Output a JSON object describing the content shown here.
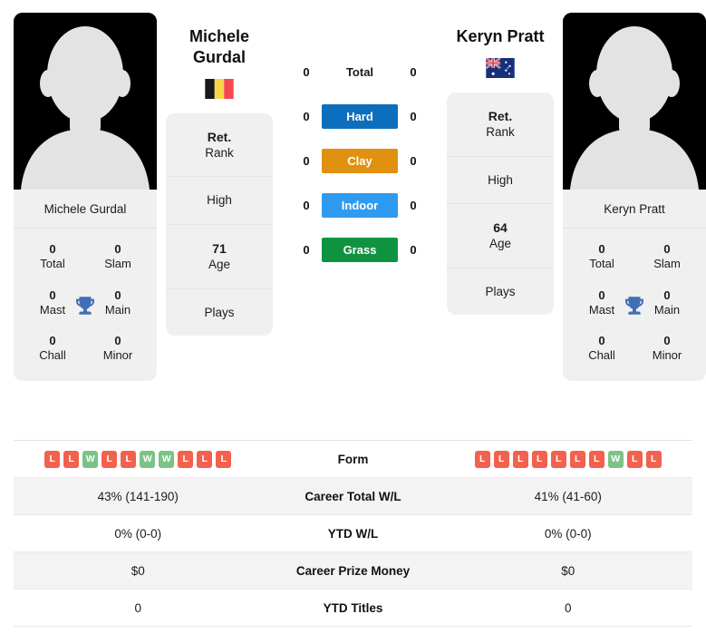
{
  "players": {
    "left": {
      "name": "Michele Gurdal",
      "name_line1": "Michele",
      "name_line2": "Gurdal",
      "photo_caption": "Michele Gurdal",
      "country": "Belgium",
      "flag_icon": "flag-belgium",
      "rank_value": "Ret.",
      "rank_label": "Rank",
      "high_value": "",
      "high_label": "High",
      "age_value": "71",
      "age_label": "Age",
      "plays_value": "",
      "plays_label": "Plays",
      "titles": {
        "total_value": "0",
        "total_label": "Total",
        "slam_value": "0",
        "slam_label": "Slam",
        "mast_value": "0",
        "mast_label": "Mast",
        "main_value": "0",
        "main_label": "Main",
        "chall_value": "0",
        "chall_label": "Chall",
        "minor_value": "0",
        "minor_label": "Minor"
      },
      "surface_scores": {
        "total": "0",
        "hard": "0",
        "clay": "0",
        "indoor": "0",
        "grass": "0"
      },
      "form": [
        "L",
        "L",
        "W",
        "L",
        "L",
        "W",
        "W",
        "L",
        "L",
        "L"
      ],
      "career_total_wl": "43% (141-190)",
      "ytd_wl": "0% (0-0)",
      "career_prize_money": "$0",
      "ytd_titles": "0"
    },
    "right": {
      "name": "Keryn Pratt",
      "name_line1": "Keryn Pratt",
      "name_line2": "",
      "photo_caption": "Keryn Pratt",
      "country": "Australia",
      "flag_icon": "flag-australia",
      "rank_value": "Ret.",
      "rank_label": "Rank",
      "high_value": "",
      "high_label": "High",
      "age_value": "64",
      "age_label": "Age",
      "plays_value": "",
      "plays_label": "Plays",
      "titles": {
        "total_value": "0",
        "total_label": "Total",
        "slam_value": "0",
        "slam_label": "Slam",
        "mast_value": "0",
        "mast_label": "Mast",
        "main_value": "0",
        "main_label": "Main",
        "chall_value": "0",
        "chall_label": "Chall",
        "minor_value": "0",
        "minor_label": "Minor"
      },
      "surface_scores": {
        "total": "0",
        "hard": "0",
        "clay": "0",
        "indoor": "0",
        "grass": "0"
      },
      "form": [
        "L",
        "L",
        "L",
        "L",
        "L",
        "L",
        "L",
        "W",
        "L",
        "L"
      ],
      "career_total_wl": "41% (41-60)",
      "ytd_wl": "0% (0-0)",
      "career_prize_money": "$0",
      "ytd_titles": "0"
    }
  },
  "surfaces": [
    {
      "key": "total",
      "label": "Total",
      "color": "transparent",
      "text_color": "#1b1b1b"
    },
    {
      "key": "hard",
      "label": "Hard",
      "color": "#0d6ebd",
      "text_color": "#ffffff"
    },
    {
      "key": "clay",
      "label": "Clay",
      "color": "#e0910f",
      "text_color": "#ffffff"
    },
    {
      "key": "indoor",
      "label": "Indoor",
      "color": "#2f9bf0",
      "text_color": "#ffffff"
    },
    {
      "key": "grass",
      "label": "Grass",
      "color": "#109340",
      "text_color": "#ffffff"
    }
  ],
  "table_rows": [
    {
      "label": "Form",
      "type": "form"
    },
    {
      "label": "Career Total W/L",
      "type": "text",
      "field": "career_total_wl"
    },
    {
      "label": "YTD W/L",
      "type": "text",
      "field": "ytd_wl"
    },
    {
      "label": "Career Prize Money",
      "type": "text",
      "field": "career_prize_money"
    },
    {
      "label": "YTD Titles",
      "type": "text",
      "field": "ytd_titles"
    }
  ],
  "colors": {
    "card_bg": "#f0f0f0",
    "win_badge": "#7cc387",
    "loss_badge": "#f2614e",
    "trophy": "#3f6fb5",
    "page_bg": "#ffffff"
  }
}
